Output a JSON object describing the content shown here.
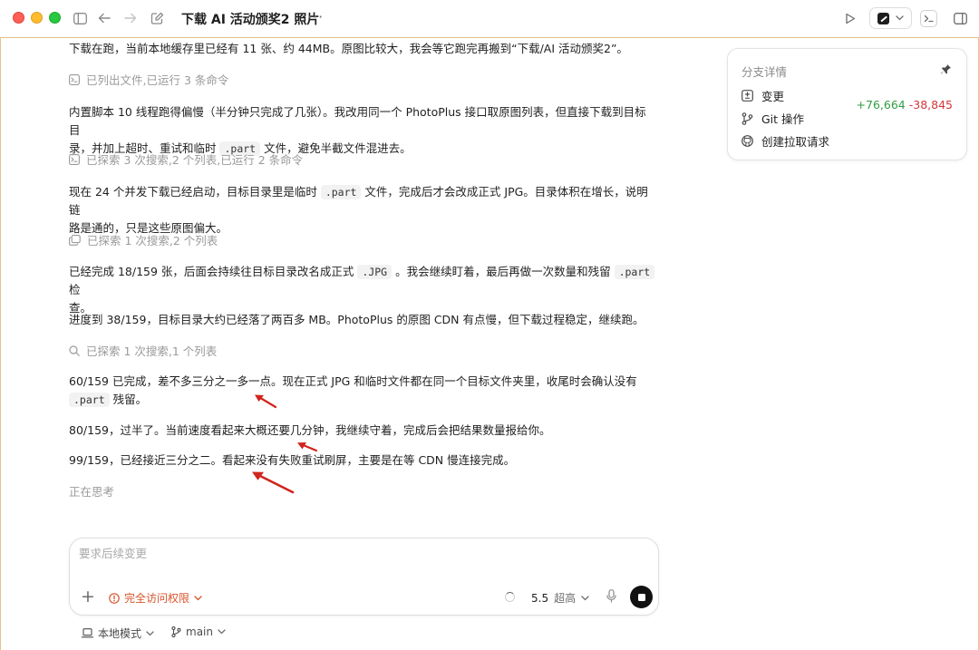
{
  "window": {
    "title": "下载 AI 活动颁奖2 照片",
    "more": "···"
  },
  "messages": [
    {
      "id": "m1",
      "text": "下载在跑，当前本地缓存里已经有 11 张、约 44MB。原图比较大，我会等它跑完再搬到“下载/AI 活动颁奖2”。"
    },
    {
      "id": "m2a",
      "text": "内置脚本 10 线程跑得偏慢（半分钟只完成了几张）。我改用同一个 PhotoPlus 接口取原图列表，但直接下载到目标目"
    },
    {
      "id": "m2b",
      "pre": "录，并加上超时、重试和临时 ",
      "code": ".part",
      "post": " 文件，避免半截文件混进去。"
    },
    {
      "id": "m3a",
      "pre": "现在 24 个并发下载已经启动，目标目录里是临时 ",
      "code": ".part",
      "post": " 文件，完成后才会改成正式 JPG。目录体积在增长，说明链"
    },
    {
      "id": "m3b",
      "text": "路是通的，只是这些原图偏大。"
    },
    {
      "id": "m4a",
      "pre": "已经完成 18/159 张，后面会持续往目标目录改名成正式 ",
      "code": ".JPG",
      "mid": " 。我会继续盯着，最后再做一次数量和残留 ",
      "code2": ".part",
      "post": " 检"
    },
    {
      "id": "m4b",
      "text": "查。"
    },
    {
      "id": "m5",
      "text": "进度到 38/159，目标目录大约已经落了两百多 MB。PhotoPlus 的原图 CDN 有点慢，但下载过程稳定，继续跑。"
    },
    {
      "id": "m6a",
      "text": "60/159 已完成，差不多三分之一多一点。现在正式 JPG 和临时文件都在同一个目标文件夹里，收尾时会确认没有"
    },
    {
      "id": "m6b",
      "code": ".part",
      "post": " 残留。"
    },
    {
      "id": "m7",
      "text": "80/159，过半了。当前速度看起来大概还要几分钟，我继续守着，完成后会把结果数量报给你。"
    },
    {
      "id": "m8",
      "text": "99/159，已经接近三分之二。看起来没有失败重试刷屏，主要是在等 CDN 慢连接完成。"
    }
  ],
  "activity": [
    {
      "icon": "terminal-icon",
      "text": "已列出文件,已运行 3 条命令"
    },
    {
      "icon": "terminal-icon",
      "text": "已探索 3 次搜索,2 个列表,已运行 2 条命令"
    },
    {
      "icon": "copy-icon",
      "text": "已探索 1 次搜索,2 个列表"
    },
    {
      "icon": "search-icon",
      "text": "已探索 1 次搜索,1 个列表"
    }
  ],
  "status": {
    "thinking": "正在思考"
  },
  "branch_panel": {
    "title": "分支详情",
    "rows": [
      {
        "icon": "changes-icon",
        "label": "变更"
      },
      {
        "icon": "git-branch-icon",
        "label": "Git 操作"
      },
      {
        "icon": "github-icon",
        "label": "创建拉取请求"
      }
    ],
    "additions": "+76,664",
    "deletions": "-38,845"
  },
  "composer": {
    "placeholder": "要求后续变更",
    "access_label": "完全访问权限",
    "model_version": "5.5",
    "model_mode": "超高"
  },
  "footer": {
    "mode_label": "本地模式",
    "branch_label": "main"
  },
  "colors": {
    "accent_border": "#e6c38a",
    "additions": "#2f9e44",
    "deletions": "#d1383d",
    "access": "#d9542b",
    "arrow": "#d0241c"
  }
}
